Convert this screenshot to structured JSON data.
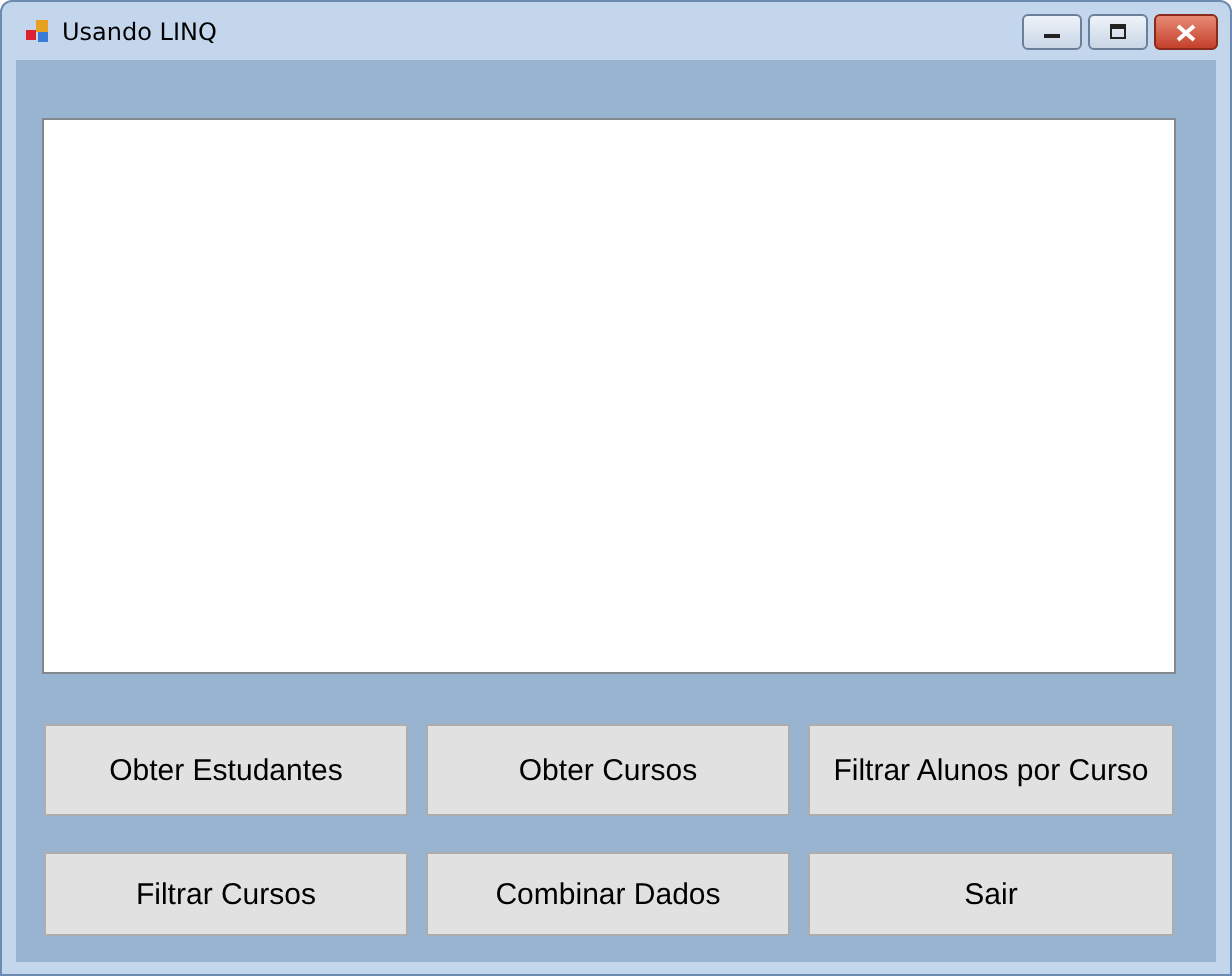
{
  "window": {
    "title": "Usando LINQ"
  },
  "buttons": [
    {
      "label": "Obter Estudantes"
    },
    {
      "label": "Obter Cursos"
    },
    {
      "label": "Filtrar Alunos por Curso"
    },
    {
      "label": "Filtrar Cursos"
    },
    {
      "label": "Combinar Dados"
    },
    {
      "label": "Sair"
    }
  ]
}
